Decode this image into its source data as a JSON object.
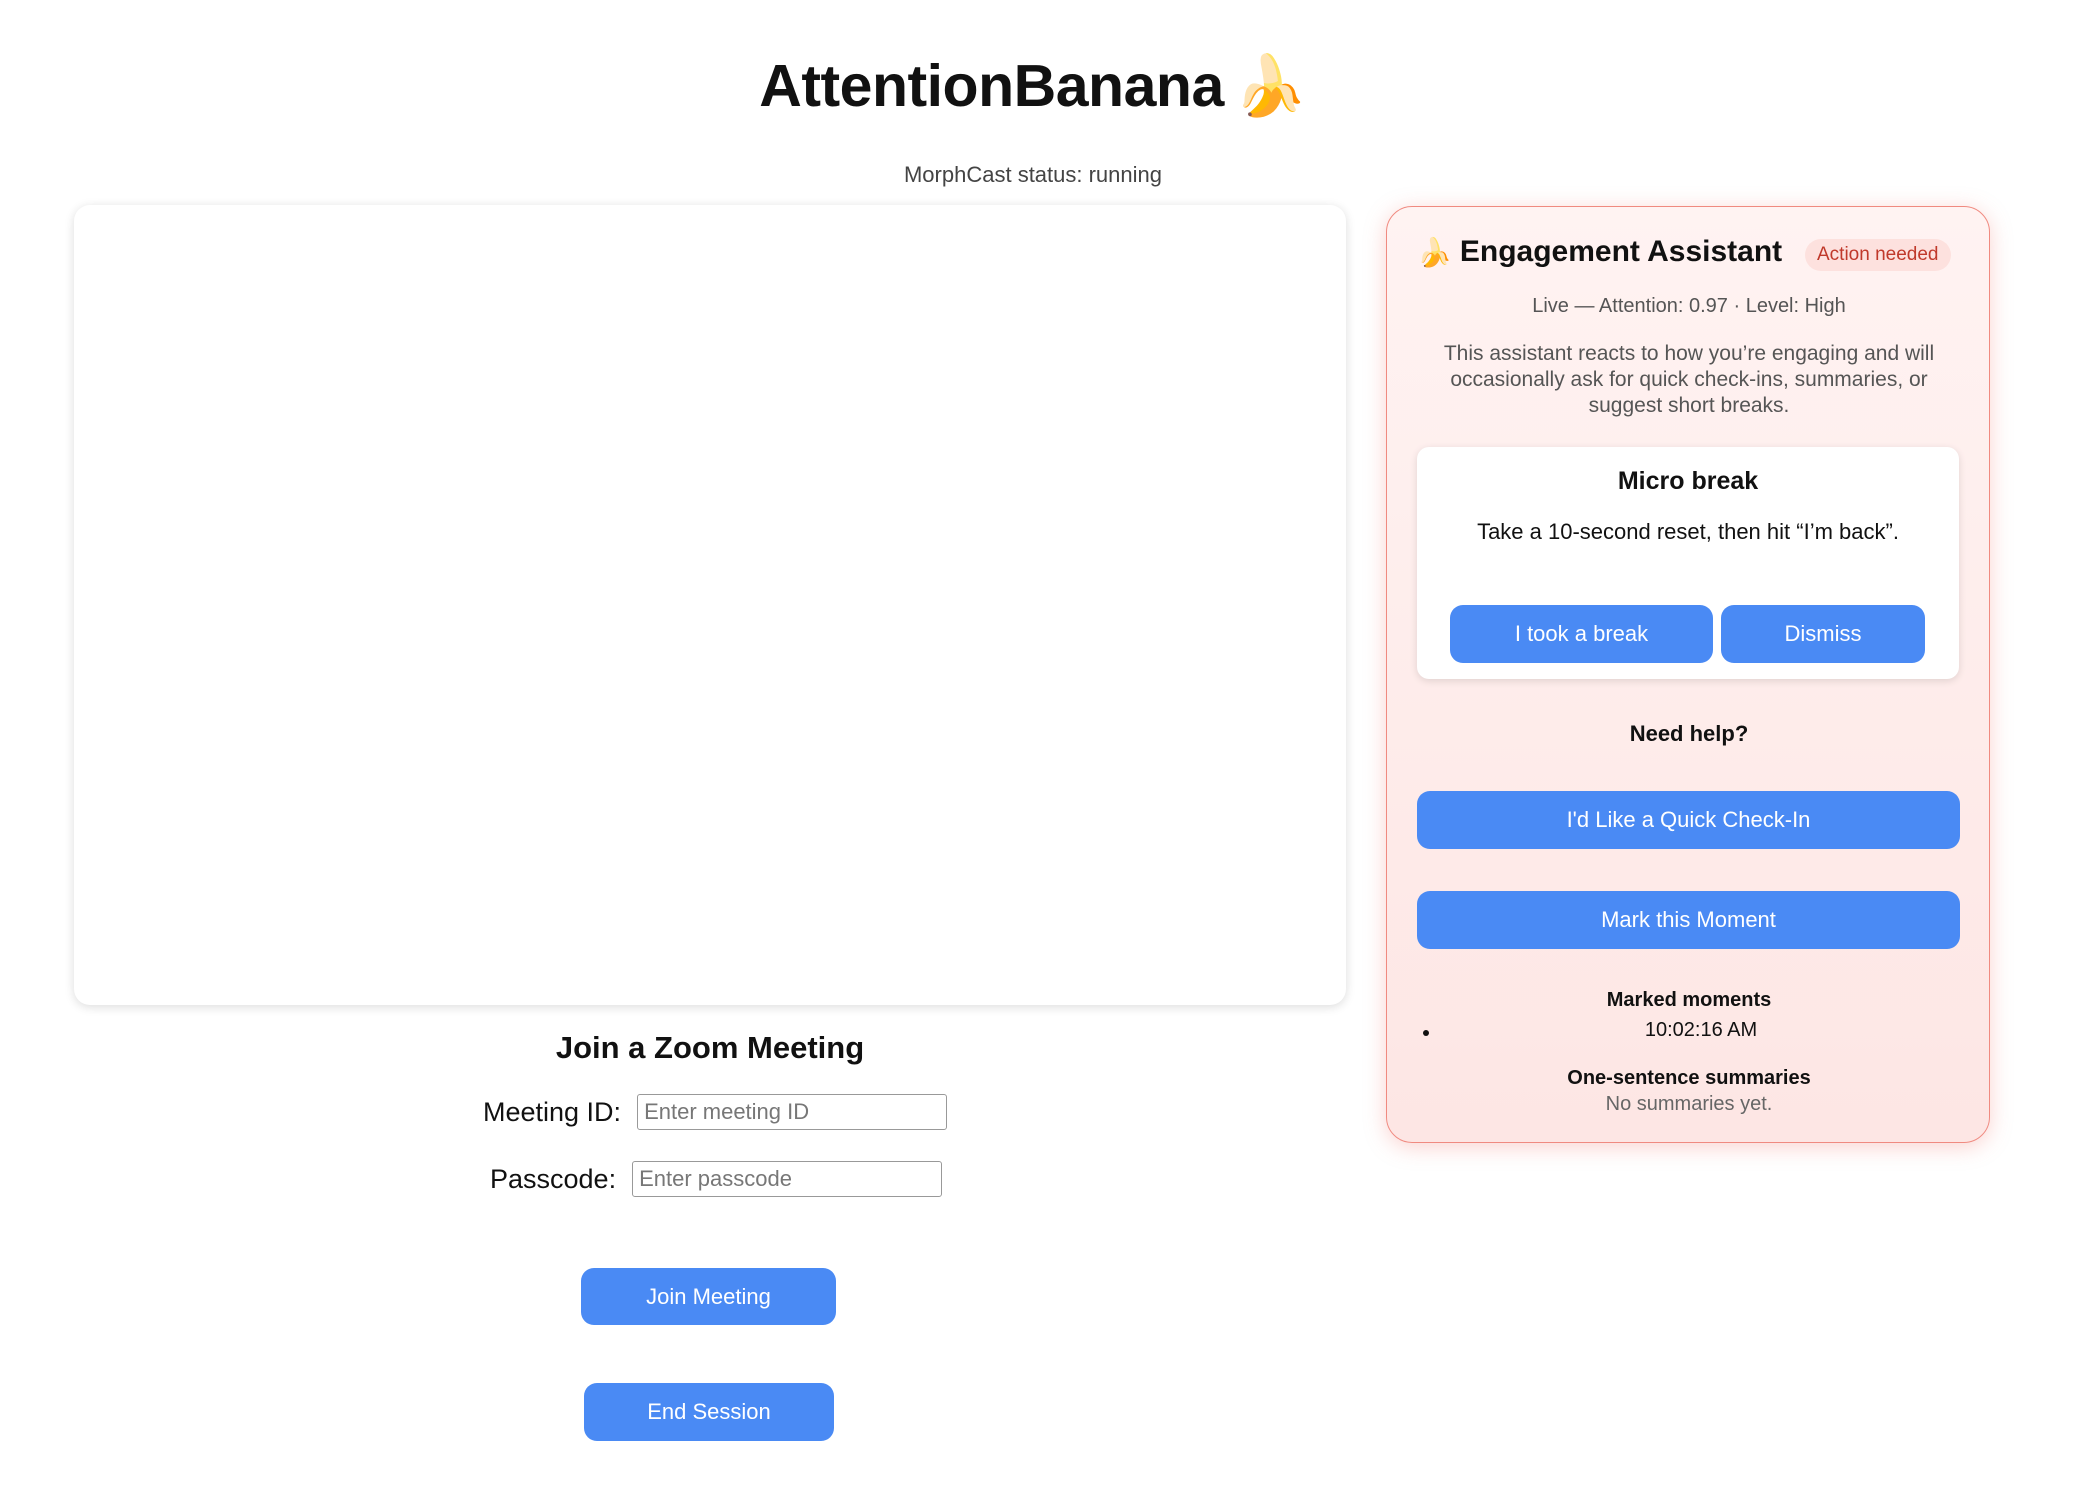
{
  "app": {
    "title": "AttentionBanana",
    "title_emoji": "🍌",
    "status_text": "MorphCast status: running"
  },
  "join": {
    "title": "Join a Zoom Meeting",
    "meeting_id_label": "Meeting ID:",
    "meeting_id_placeholder": "Enter meeting ID",
    "passcode_label": "Passcode:",
    "passcode_placeholder": "Enter passcode",
    "join_button": "Join Meeting",
    "end_button": "End Session"
  },
  "assistant": {
    "title_emoji": "🍌",
    "title": "Engagement Assistant",
    "badge": "Action needed",
    "live_status": "Live — Attention: 0.97 · Level: High",
    "description": "This assistant reacts to how you’re engaging and will occasionally ask for quick check-ins, summaries, or suggest short breaks.",
    "break_card": {
      "title": "Micro break",
      "text": "Take a 10-second reset, then hit “I’m back”.",
      "took_break_button": "I took a break",
      "dismiss_button": "Dismiss"
    },
    "need_help_heading": "Need help?",
    "check_in_button": "I'd Like a Quick Check-In",
    "mark_moment_button": "Mark this Moment",
    "marked_moments_heading": "Marked moments",
    "marked_moments": [
      "10:02:16 AM"
    ],
    "summaries_heading": "One-sentence summaries",
    "summaries_empty": "No summaries yet."
  },
  "colors": {
    "accent": "#4a8af4",
    "panel_border": "#f08a80",
    "badge_text": "#c0392b"
  }
}
